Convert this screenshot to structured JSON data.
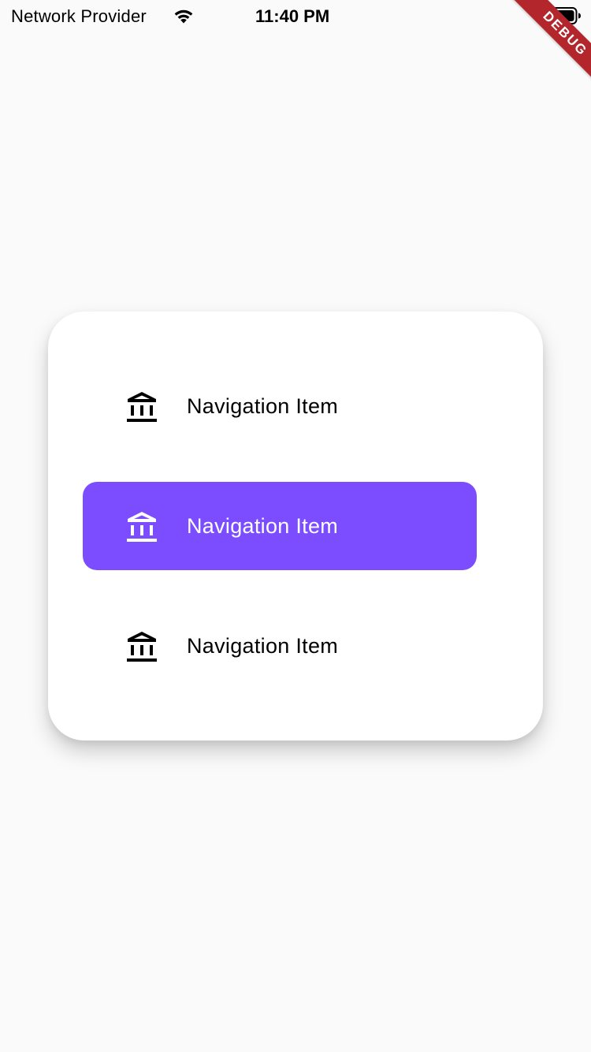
{
  "status_bar": {
    "carrier": "Network Provider",
    "time": "11:40 PM",
    "wifi_icon": "wifi-icon",
    "battery_icon": "battery-full-icon"
  },
  "debug_banner": {
    "label": "DEBUG",
    "color": "#b3262b"
  },
  "navigation": {
    "items": [
      {
        "label": "Navigation Item",
        "icon": "bank-icon",
        "selected": false
      },
      {
        "label": "Navigation Item",
        "icon": "bank-icon",
        "selected": true
      },
      {
        "label": "Navigation Item",
        "icon": "bank-icon",
        "selected": false
      }
    ],
    "accent_color": "#7c4dff",
    "card_color": "#ffffff",
    "background_color": "#fafafa"
  }
}
